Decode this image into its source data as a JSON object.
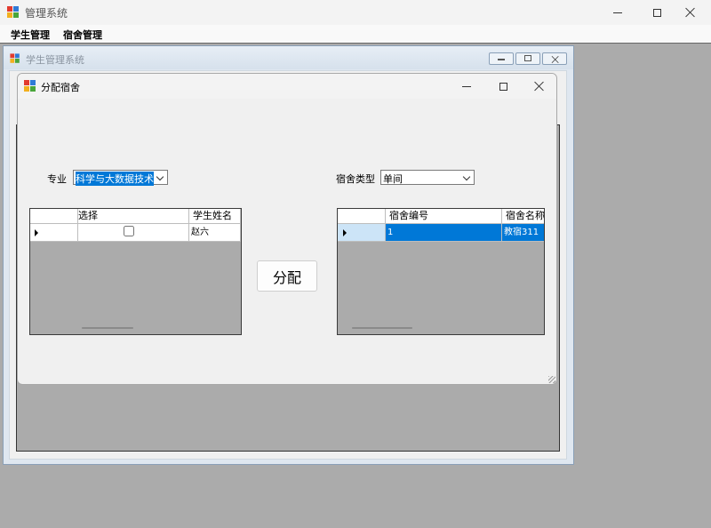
{
  "main_window": {
    "title": "管理系统",
    "menu": [
      "学生管理",
      "宿舍管理"
    ]
  },
  "mdi_child": {
    "title": "学生管理系统"
  },
  "dialog": {
    "title": "分配宿舍",
    "major_label": "专业",
    "major_value": "科学与大数据技术",
    "dorm_type_label": "宿舍类型",
    "dorm_type_value": "单间",
    "assign_button": "分配"
  },
  "student_grid": {
    "columns": [
      "选择",
      "学生姓名"
    ],
    "rows": [
      {
        "checked": false,
        "name": "赵六"
      }
    ]
  },
  "dorm_grid": {
    "columns": [
      "宿舍编号",
      "宿舍名称"
    ],
    "rows": [
      {
        "id": "1",
        "name": "教宿311",
        "selected": true
      }
    ]
  },
  "colors": {
    "selection": "#0078d7",
    "desktop": "#ababab",
    "form_bg": "#f0f0f0"
  }
}
